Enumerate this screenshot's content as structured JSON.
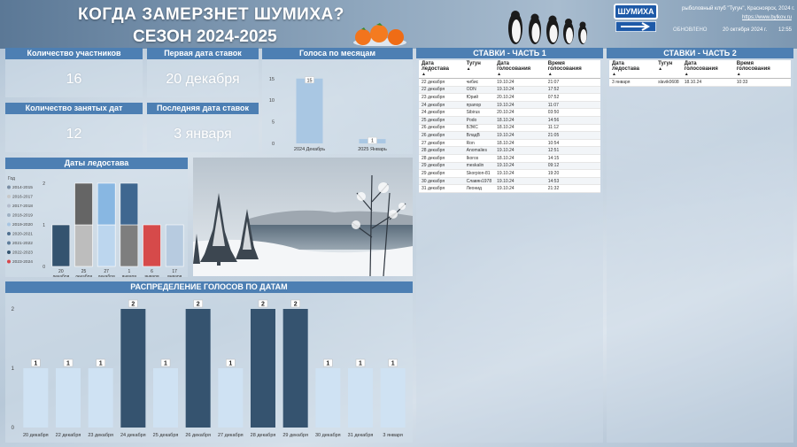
{
  "header": {
    "title_line1": "КОГДА ЗАМЕРЗНЕТ ШУМИХА?",
    "title_line2": "СЕЗОН 2024-2025",
    "sign_label": "ШУМИХА",
    "club_text": "рыболовный клуб \"Тугун\", Красноярск, 2024 г.",
    "club_link": "https://www.bylkov.ru",
    "updated_label": "ОБНОВЛЕНО",
    "updated_date": "20 октября 2024 г.",
    "updated_time": "12:55"
  },
  "kpis": {
    "participants": {
      "label": "Количество участников",
      "value": "16"
    },
    "first_date": {
      "label": "Первая дата ставок",
      "value": "20 декабря"
    },
    "occupied": {
      "label": "Количество занятых дат",
      "value": "12"
    },
    "last_date": {
      "label": "Последняя дата ставок",
      "value": "3 января"
    }
  },
  "votes_by_month": {
    "title": "Голоса по месяцам",
    "chart_data": {
      "type": "bar",
      "categories": [
        "2024 Декабрь",
        "2025 Январь"
      ],
      "values": [
        15,
        1
      ],
      "yticks": [
        0,
        5,
        10,
        15
      ],
      "ylim": [
        0,
        17
      ]
    }
  },
  "ice_dates": {
    "title": "Даты ледостава",
    "legend_title": "Год",
    "chart_data": {
      "type": "bar",
      "stacked": true,
      "categories": [
        "20 декабря",
        "25 декабря",
        "27 декабря",
        "1 января",
        "6 января",
        "17 января"
      ],
      "series": [
        {
          "name": "2014-2015",
          "color": "#7b8fa5"
        },
        {
          "name": "2016-2017",
          "color": "#c8c8c8"
        },
        {
          "name": "2017-2018",
          "color": "#b4bccc"
        },
        {
          "name": "2018-2019",
          "color": "#9fb0c2"
        },
        {
          "name": "2019-2020",
          "color": "#a7c5e2"
        },
        {
          "name": "2020-2021",
          "color": "#4f6f8f"
        },
        {
          "name": "2021-2022",
          "color": "#5f7d9b"
        },
        {
          "name": "2022-2023",
          "color": "#34546f"
        },
        {
          "name": "2023-2024",
          "color": "#d9464a"
        }
      ],
      "stacks": [
        [
          {
            "series": "2020-2021",
            "value": 1,
            "color": "#34536f"
          }
        ],
        [
          {
            "series": "2016-2017",
            "value": 1,
            "color": "#bdbdbd"
          },
          {
            "series": "2017-2018",
            "value": 1,
            "color": "#656565"
          }
        ],
        [
          {
            "series": "2019-2020",
            "value": 1,
            "color": "#bcd6ee"
          },
          {
            "series": "2018-2019",
            "value": 1,
            "color": "#88b7e2"
          }
        ],
        [
          {
            "series": "2014-2015",
            "value": 1,
            "color": "#7e7e7e"
          },
          {
            "series": "2021-2022",
            "value": 1,
            "color": "#3f6790"
          }
        ],
        [
          {
            "series": "2023-2024",
            "value": 1,
            "color": "#d64a4a"
          }
        ],
        [
          {
            "series": "2022-2023",
            "value": 1,
            "color": "#b7cbe0"
          }
        ]
      ],
      "yticks": [
        0,
        1,
        2
      ],
      "ylim": [
        0,
        2
      ]
    }
  },
  "distribution": {
    "title": "РАСПРЕДЕЛЕНИЕ ГОЛОСОВ ПО ДАТАМ",
    "chart_data": {
      "type": "bar",
      "categories": [
        "20 декабря",
        "22 декабря",
        "23 декабря",
        "24 декабря",
        "25 декабря",
        "26 декабря",
        "27 декабря",
        "28 декабря",
        "29 декабря",
        "30 декабря",
        "31 декабря",
        "3 января"
      ],
      "values": [
        1,
        1,
        1,
        2,
        1,
        2,
        1,
        2,
        2,
        1,
        1,
        1
      ],
      "yticks": [
        0,
        1,
        2
      ],
      "ylim": [
        0,
        2
      ]
    }
  },
  "bets1": {
    "title": "СТАВКИ - ЧАСТЬ 1",
    "columns": [
      "Дата ледостава",
      "Тугун",
      "Дата голосования",
      "Время голосования"
    ],
    "rows": [
      [
        "22 декабря",
        "чибис",
        "19.10.24",
        "21:07"
      ],
      [
        "22 декабря",
        "ODN",
        "19.10.24",
        "17:52"
      ],
      [
        "23 декабря",
        "Юрий",
        "20.10.24",
        "07:52"
      ],
      [
        "24 декабря",
        "прапор",
        "19.10.24",
        "11:07"
      ],
      [
        "24 декабря",
        "Sibirus",
        "20.10.24",
        "03:50"
      ],
      [
        "25 декабря",
        "Podo",
        "18.10.24",
        "14:56"
      ],
      [
        "26 декабря",
        "БЭКС",
        "18.10.24",
        "11:12"
      ],
      [
        "26 декабря",
        "ВладВ",
        "19.10.24",
        "21:05"
      ],
      [
        "27 декабря",
        "Ron",
        "18.10.24",
        "10:54"
      ],
      [
        "28 декабря",
        "Anomalies",
        "19.10.24",
        "12:51"
      ],
      [
        "28 декабря",
        "Ikoros",
        "18.10.24",
        "14:15"
      ],
      [
        "29 декабря",
        "meskalin",
        "19.10.24",
        "09:12"
      ],
      [
        "29 декабря",
        "Skorpion-81",
        "19.10.24",
        "19:20"
      ],
      [
        "30 декабря",
        "Славян1978",
        "19.10.24",
        "14:53"
      ],
      [
        "31 декабря",
        "Леонид",
        "19.10.24",
        "21:32"
      ]
    ]
  },
  "bets2": {
    "title": "СТАВКИ - ЧАСТЬ 2",
    "columns": [
      "Дата ледостава",
      "Тугун",
      "Дата голосования",
      "Время голосования"
    ],
    "rows": [
      [
        "3 января",
        "slavik0608",
        "18.10.24",
        "10:33"
      ]
    ]
  }
}
